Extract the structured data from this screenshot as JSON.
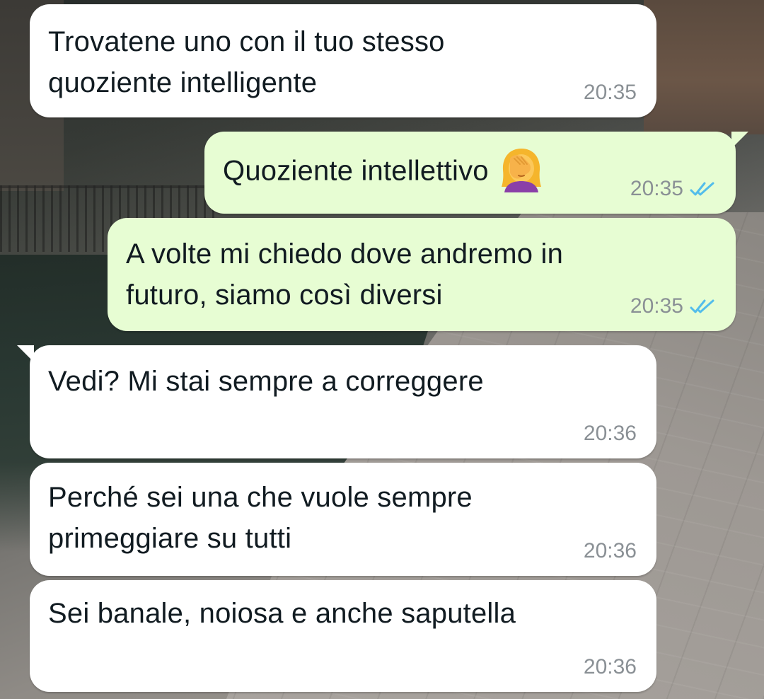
{
  "chat": {
    "messages": [
      {
        "direction": "incoming",
        "text": "Trovatene uno con il tuo stesso\nquoziente intelligente",
        "time": "20:35"
      },
      {
        "direction": "outgoing",
        "text": "Quoziente intellettivo",
        "emoji": "woman-facepalming-icon",
        "time": "20:35",
        "status": "read"
      },
      {
        "direction": "outgoing",
        "text": "A volte mi chiedo dove andremo in\nfuturo, siamo così diversi",
        "time": "20:35",
        "status": "read"
      },
      {
        "direction": "incoming",
        "text": "Vedi? Mi stai sempre a correggere",
        "time": "20:36"
      },
      {
        "direction": "incoming",
        "text": "Perché sei una che vuole sempre\nprimeggiare su tutti",
        "time": "20:36"
      },
      {
        "direction": "incoming",
        "text": "Sei banale, noiosa e anche saputella",
        "time": "20:36"
      }
    ]
  },
  "colors": {
    "incoming_bubble": "#ffffff",
    "outgoing_bubble": "#e7fdd3",
    "timestamp": "#8a9095",
    "read_ticks": "#53bdeb",
    "text": "#111b21"
  }
}
